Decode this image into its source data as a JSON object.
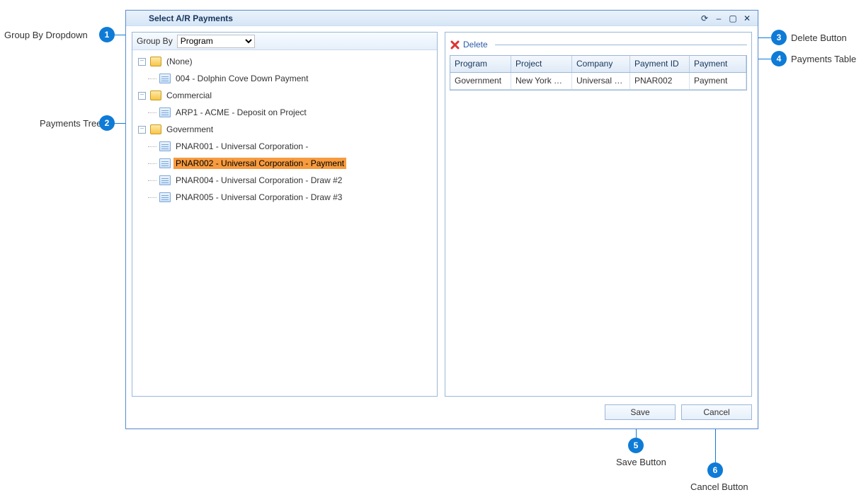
{
  "annotations": {
    "a1": {
      "num": "1",
      "label": "Group By Dropdown"
    },
    "a2": {
      "num": "2",
      "label": "Payments Tree"
    },
    "a3": {
      "num": "3",
      "label": "Delete Button"
    },
    "a4": {
      "num": "4",
      "label": "Payments Table"
    },
    "a5": {
      "num": "5",
      "label": "Save Button"
    },
    "a6": {
      "num": "6",
      "label": "Cancel Button"
    }
  },
  "window": {
    "title": "Select A/R Payments",
    "controls": {
      "refresh": "⟳",
      "minimize": "–",
      "maximize": "▢",
      "close": "✕"
    }
  },
  "groupby": {
    "label": "Group By",
    "value": "Program"
  },
  "tree": {
    "nodes": [
      {
        "expander": "−",
        "icon": "folder",
        "label": "(None)"
      },
      {
        "depth": 1,
        "icon": "doc",
        "label": "004 - Dolphin Cove Down Payment"
      },
      {
        "expander": "−",
        "icon": "folder",
        "label": "Commercial"
      },
      {
        "depth": 1,
        "icon": "doc",
        "label": "ARP1 - ACME - Deposit on Project"
      },
      {
        "expander": "−",
        "icon": "folder",
        "label": "Government"
      },
      {
        "depth": 1,
        "icon": "doc",
        "label": "PNAR001 - Universal Corporation -"
      },
      {
        "depth": 1,
        "icon": "doc",
        "label": "PNAR002 - Universal Corporation - Payment",
        "selected": true
      },
      {
        "depth": 1,
        "icon": "doc",
        "label": "PNAR004 - Universal Corporation - Draw #2"
      },
      {
        "depth": 1,
        "icon": "doc",
        "label": "PNAR005 - Universal Corporation - Draw #3"
      }
    ]
  },
  "delete": {
    "label": "Delete"
  },
  "table": {
    "columns": {
      "c1": "Program",
      "c2": "Project",
      "c3": "Company",
      "c4": "Payment ID",
      "c5": "Payment"
    },
    "row": {
      "c1": "Government",
      "c2": "New York City",
      "c3": "Universal Corp",
      "c4": "PNAR002",
      "c5": "Payment"
    }
  },
  "buttons": {
    "save": "Save",
    "cancel": "Cancel"
  }
}
